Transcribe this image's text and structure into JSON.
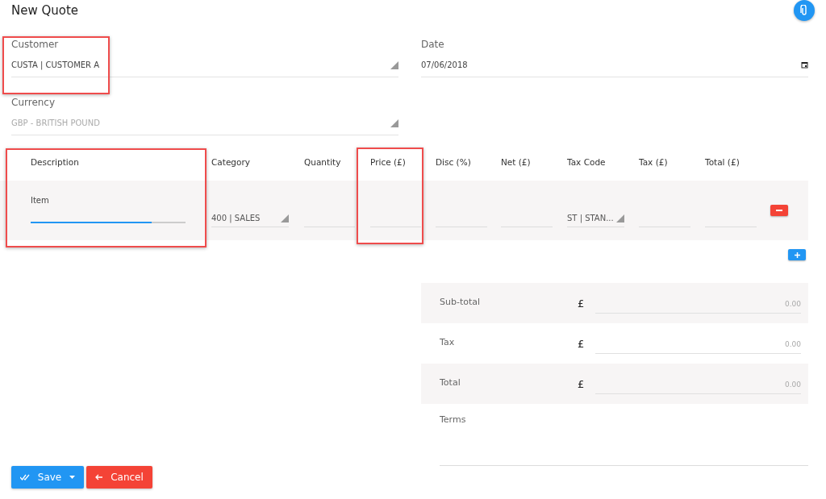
{
  "title": "New Quote",
  "header_fields": [
    {
      "label": "Customer",
      "value": "CUSTA | CUSTOMER A",
      "kind": "select",
      "disabled": false
    },
    {
      "label": "Date",
      "value": "07/06/2018",
      "kind": "date",
      "disabled": false
    },
    {
      "label": "Currency",
      "value": "GBP - BRITISH POUND",
      "kind": "select",
      "disabled": true
    }
  ],
  "line_items": {
    "columns": [
      "Description",
      "Category",
      "Quantity",
      "Price (£)",
      "Disc (%)",
      "Net (£)",
      "Tax Code",
      "Tax (£)",
      "Total (£)"
    ],
    "rows": [
      {
        "cells": [
          {
            "kind": "text",
            "value": "Item",
            "focused": true
          },
          {
            "kind": "select",
            "value": "400 | SALES"
          },
          {
            "kind": "text"
          },
          {
            "kind": "text"
          },
          {
            "kind": "text"
          },
          {
            "kind": "text"
          },
          {
            "kind": "select",
            "value": "ST | STAN..."
          },
          {
            "kind": "text"
          },
          {
            "kind": "text"
          }
        ]
      }
    ]
  },
  "totals": [
    {
      "label": "Sub-total",
      "currency": "£",
      "value": "0.00"
    },
    {
      "label": "Tax",
      "currency": "£",
      "value": "0.00"
    },
    {
      "label": "Total",
      "currency": "£",
      "value": "0.00"
    }
  ],
  "terms": {
    "label": "Terms"
  },
  "buttons": [
    {
      "kind": "save",
      "label": "Save"
    },
    {
      "kind": "cancel",
      "label": "Cancel"
    }
  ]
}
